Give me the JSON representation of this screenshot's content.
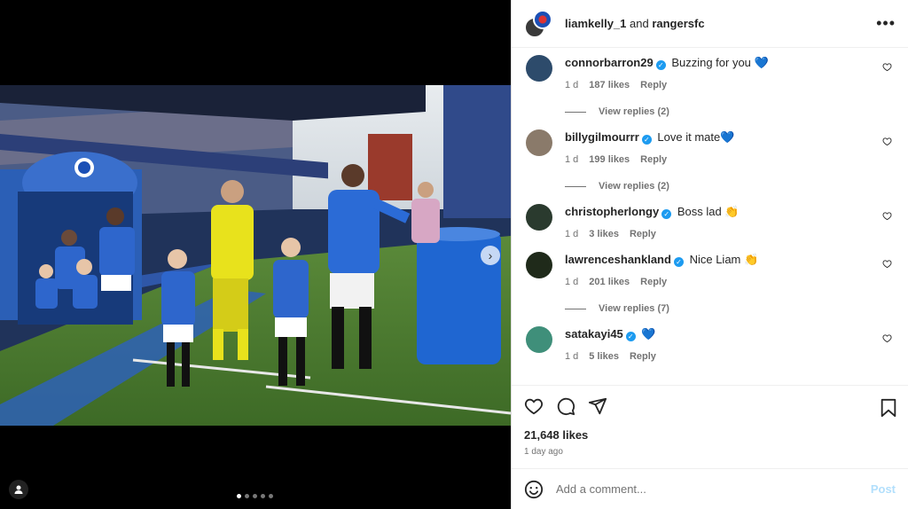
{
  "header": {
    "user1": "liamkelly_1",
    "joiner": " and ",
    "user2": "rangersfc",
    "more_label": "•••"
  },
  "comments": [
    {
      "user": "connorbarron29",
      "verified": true,
      "text": "Buzzing for you 💙",
      "time": "1 d",
      "likes": "187 likes",
      "reply": "Reply",
      "view_replies": "View replies (2)",
      "avatar_color": "#2d4b6b"
    },
    {
      "user": "billygilmourrr",
      "verified": true,
      "text": "Love it mate💙",
      "time": "1 d",
      "likes": "199 likes",
      "reply": "Reply",
      "view_replies": "View replies (2)",
      "avatar_color": "#8a7a6a"
    },
    {
      "user": "christopherlongy",
      "verified": true,
      "text": "Boss lad 👏",
      "time": "1 d",
      "likes": "3 likes",
      "reply": "Reply",
      "view_replies": null,
      "avatar_color": "#2a3a2e"
    },
    {
      "user": "lawrenceshankland",
      "verified": true,
      "text": "Nice Liam 👏",
      "time": "1 d",
      "likes": "201 likes",
      "reply": "Reply",
      "view_replies": "View replies (7)",
      "avatar_color": "#1f2a1a"
    },
    {
      "user": "satakayi45",
      "verified": true,
      "text": "💙",
      "time": "1 d",
      "likes": "5 likes",
      "reply": "Reply",
      "view_replies": null,
      "avatar_color": "#3f8f7a"
    }
  ],
  "post": {
    "likes_count": "21,648 likes",
    "time_ago": "1 day ago"
  },
  "composer": {
    "placeholder": "Add a comment...",
    "post_label": "Post"
  },
  "carousel": {
    "next_label": "›",
    "total_slides": 5,
    "active_slide": 1
  },
  "colors": {
    "verified": "#1d9bf0",
    "post_disabled": "#b2dffc",
    "kit_blue": "#1b4fb5"
  }
}
